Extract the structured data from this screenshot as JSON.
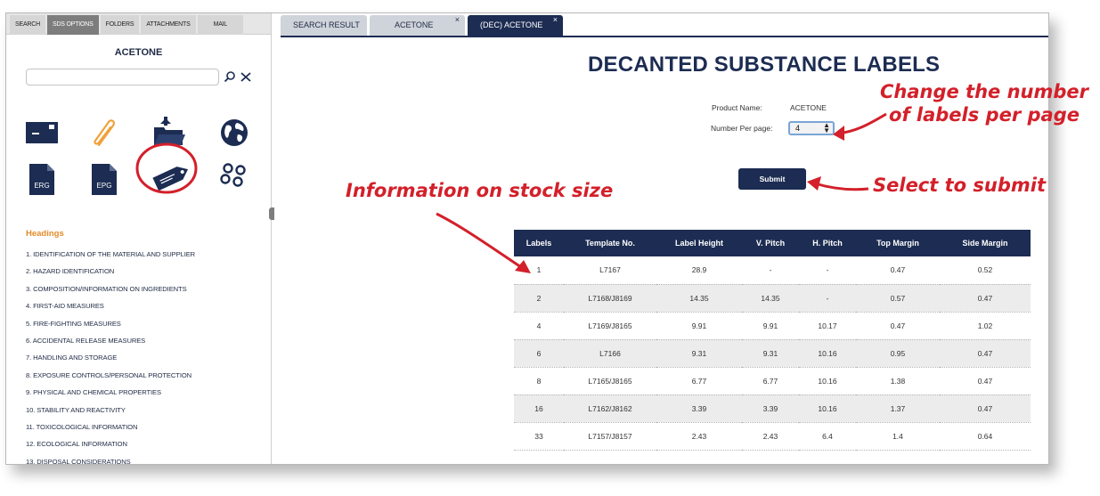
{
  "left_panel": {
    "tabs": [
      {
        "label": "SEARCH",
        "active": false
      },
      {
        "label": "SDS OPTIONS",
        "active": true
      },
      {
        "label": "FOLDERS",
        "active": false
      },
      {
        "label": "ATTACHMENTS",
        "active": false
      },
      {
        "label": "MAIL",
        "active": false
      }
    ],
    "title": "ACETONE",
    "search": {
      "value": "",
      "placeholder": ""
    },
    "icons": [
      {
        "name": "envelope-icon"
      },
      {
        "name": "paperclip-icon"
      },
      {
        "name": "open-folder-icon"
      },
      {
        "name": "globe-icon"
      },
      {
        "name": "erg-document-icon",
        "label": "ERG"
      },
      {
        "name": "epg-document-icon",
        "label": "EPG"
      },
      {
        "name": "decanted-label-tag-icon"
      },
      {
        "name": "chain-link-icon"
      }
    ],
    "headings_title": "Headings",
    "headings": [
      "1. IDENTIFICATION OF THE MATERIAL AND SUPPLIER",
      "2. HAZARD IDENTIFICATION",
      "3. COMPOSITION/INFORMATION ON INGREDIENTS",
      "4. FIRST-AID MEASURES",
      "5. FIRE-FIGHTING MEASURES",
      "6. ACCIDENTAL RELEASE MEASURES",
      "7. HANDLING AND STORAGE",
      "8. EXPOSURE CONTROLS/PERSONAL PROTECTION",
      "9. PHYSICAL AND CHEMICAL PROPERTIES",
      "10. STABILITY AND REACTIVITY",
      "11. TOXICOLOGICAL INFORMATION",
      "12. ECOLOGICAL INFORMATION",
      "13. DISPOSAL CONSIDERATIONS"
    ]
  },
  "doc_tabs": [
    {
      "label": "SEARCH RESULT",
      "closable": false,
      "active": false
    },
    {
      "label": "ACETONE",
      "closable": true,
      "active": false
    },
    {
      "label": "(DEC) ACETONE",
      "closable": true,
      "active": true
    }
  ],
  "close_glyph": "×",
  "main": {
    "title": "DECANTED SUBSTANCE LABELS",
    "product_name_label": "Product Name:",
    "product_name_value": "ACETONE",
    "number_per_page_label": "Number Per page:",
    "number_per_page_value": "4",
    "submit_label": "Submit"
  },
  "table": {
    "headers": [
      "Labels",
      "Template No.",
      "Label Height",
      "V. Pitch",
      "H. Pitch",
      "Top Margin",
      "Side Margin"
    ],
    "rows": [
      [
        "1",
        "L7167",
        "28.9",
        "-",
        "-",
        "0.47",
        "0.52"
      ],
      [
        "2",
        "L7168/J8169",
        "14.35",
        "14.35",
        "-",
        "0.57",
        "0.47"
      ],
      [
        "4",
        "L7169/J8165",
        "9.91",
        "9.91",
        "10.17",
        "0.47",
        "1.02"
      ],
      [
        "6",
        "L7166",
        "9.31",
        "9.31",
        "10.16",
        "0.95",
        "0.47"
      ],
      [
        "8",
        "L7165/J8165",
        "6.77",
        "6.77",
        "10.16",
        "1.38",
        "0.47"
      ],
      [
        "16",
        "L7162/J8162",
        "3.39",
        "3.39",
        "10.16",
        "1.37",
        "0.47"
      ],
      [
        "33",
        "L7157/J8157",
        "2.43",
        "2.43",
        "6.4",
        "1.4",
        "0.64"
      ]
    ]
  },
  "annotations": {
    "change_number": "Change the number of labels per page",
    "select_submit": "Select to submit",
    "stock_size": "Information on stock size"
  },
  "colors": {
    "navy": "#1c2c52",
    "annotation_red": "#d3202a",
    "headings_orange": "#e38b2a"
  }
}
